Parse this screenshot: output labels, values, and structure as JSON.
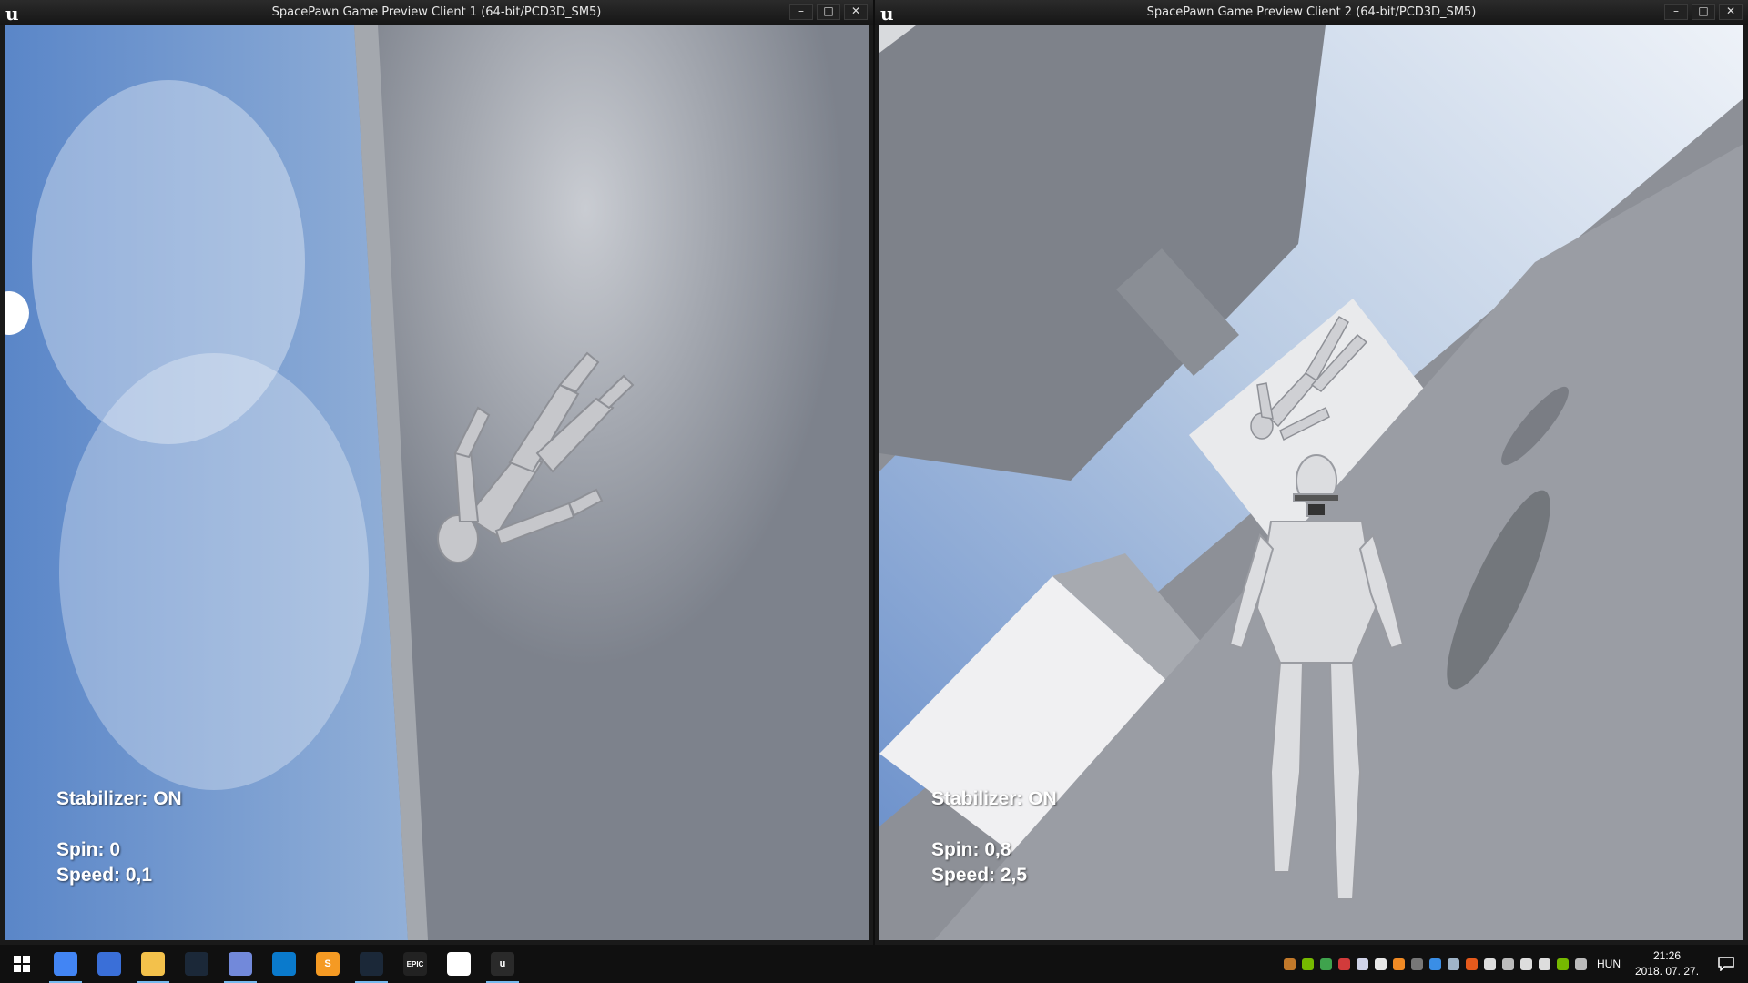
{
  "windows": [
    {
      "title": "SpacePawn Game Preview Client 1 (64-bit/PCD3D_SM5)",
      "hud": {
        "stabilizer": "Stabilizer: ON",
        "spin": "Spin: 0",
        "speed": "Speed: 0,1"
      }
    },
    {
      "title": "SpacePawn Game Preview Client 2 (64-bit/PCD3D_SM5)",
      "hud": {
        "stabilizer": "Stabilizer: ON",
        "spin": "Spin: 0,8",
        "speed": "Speed: 2,5"
      }
    }
  ],
  "window_buttons": {
    "minimize": "–",
    "maximize": "□",
    "close": "✕"
  },
  "ue_logo": "u",
  "taskbar": {
    "start_icon": "windows-start-icon",
    "apps": [
      {
        "name": "chrome-icon",
        "glyph": "",
        "color": "#4285f4",
        "running": true
      },
      {
        "name": "save-disk-icon",
        "glyph": "",
        "color": "#3a6fd8",
        "running": false
      },
      {
        "name": "file-explorer-icon",
        "glyph": "",
        "color": "#f3c14b",
        "running": true
      },
      {
        "name": "steam-icon",
        "glyph": "",
        "color": "#1b2838",
        "running": false
      },
      {
        "name": "discord-icon",
        "glyph": "",
        "color": "#7289da",
        "running": true
      },
      {
        "name": "vscode-icon",
        "glyph": "",
        "color": "#0a7acc",
        "running": false
      },
      {
        "name": "sublime-text-icon",
        "glyph": "S",
        "color": "#f59a23",
        "running": false
      },
      {
        "name": "steam-running-icon",
        "glyph": "",
        "color": "#1b2838",
        "running": true
      },
      {
        "name": "epic-games-icon",
        "glyph": "EPIC",
        "color": "#222222",
        "running": false
      },
      {
        "name": "oculus-icon",
        "glyph": "",
        "color": "#ffffff",
        "running": false
      },
      {
        "name": "unreal-engine-icon",
        "glyph": "u",
        "color": "#2a2a2a",
        "running": true
      }
    ],
    "tray": [
      {
        "name": "tray-app-icon",
        "color": "#c2792a"
      },
      {
        "name": "nvidia-icon",
        "color": "#76b900"
      },
      {
        "name": "tray-green-icon",
        "color": "#3fa34d"
      },
      {
        "name": "tray-red-icon",
        "color": "#d23b3b"
      },
      {
        "name": "discord-tray-icon",
        "color": "#cfd3e8"
      },
      {
        "name": "cloud-icon",
        "color": "#e8e8e8"
      },
      {
        "name": "tray-orange-icon",
        "color": "#f08a24"
      },
      {
        "name": "tray-epic-icon",
        "color": "#777777"
      },
      {
        "name": "tray-blue-icon",
        "color": "#3a8ee6"
      },
      {
        "name": "steam-tray-icon",
        "color": "#9fb4c8"
      },
      {
        "name": "tray-orange2-icon",
        "color": "#e55a1c"
      },
      {
        "name": "shield-icon",
        "color": "#dddddd"
      },
      {
        "name": "onedrive-icon",
        "color": "#bbbbbb"
      },
      {
        "name": "network-icon",
        "color": "#dddddd"
      },
      {
        "name": "volume-icon",
        "color": "#dddddd"
      },
      {
        "name": "nvidia-tray-icon",
        "color": "#76b900"
      },
      {
        "name": "wifi-icon",
        "color": "#bbbbbb"
      }
    ],
    "language": "HUN",
    "time": "21:26",
    "date": "2018. 07. 27."
  }
}
